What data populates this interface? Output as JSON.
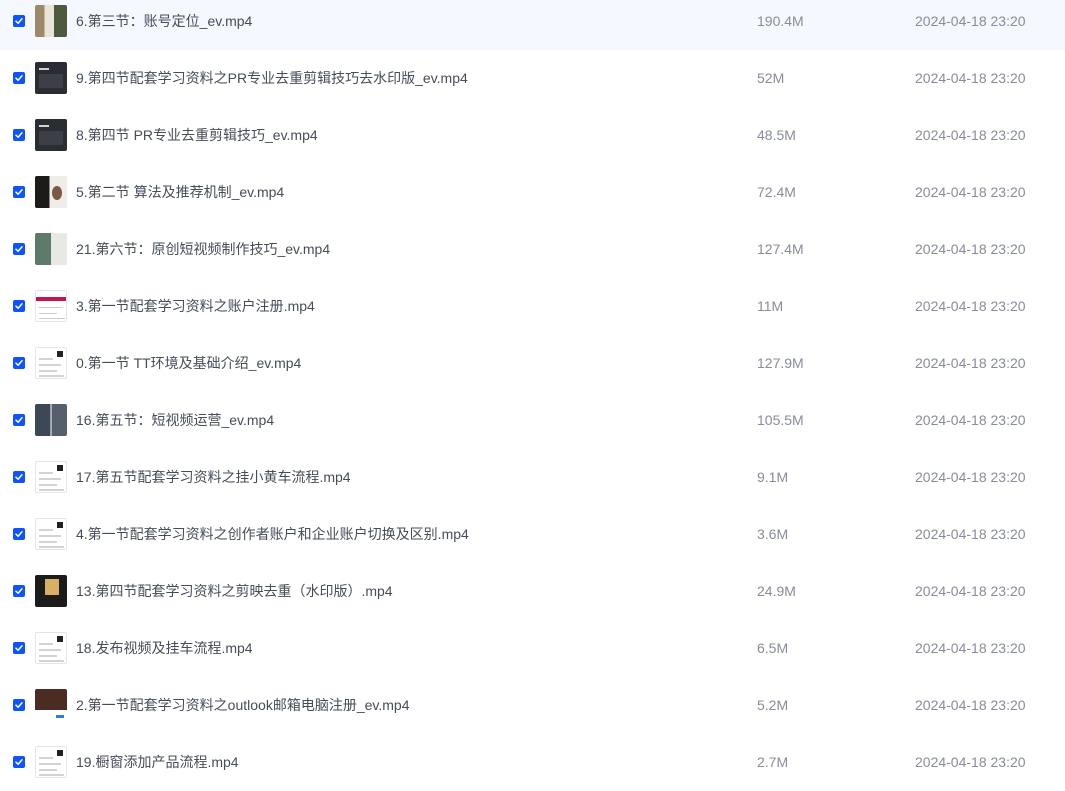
{
  "checkbox_color": "#0d53ff",
  "files": [
    {
      "name": "6.第三节：账号定位_ev.mp4",
      "size": "190.4M",
      "time": "2024-04-18 23:20",
      "checked": true,
      "thumb": "photo"
    },
    {
      "name": "9.第四节配套学习资料之PR专业去重剪辑技巧去水印版_ev.mp4",
      "size": "52M",
      "time": "2024-04-18 23:20",
      "checked": true,
      "thumb": "dark"
    },
    {
      "name": "8.第四节 PR专业去重剪辑技巧_ev.mp4",
      "size": "48.5M",
      "time": "2024-04-18 23:20",
      "checked": true,
      "thumb": "dark"
    },
    {
      "name": "5.第二节 算法及推荐机制_ev.mp4",
      "size": "72.4M",
      "time": "2024-04-18 23:20",
      "checked": true,
      "thumb": "portrait"
    },
    {
      "name": "21.第六节：原创短视频制作技巧_ev.mp4",
      "size": "127.4M",
      "time": "2024-04-18 23:20",
      "checked": true,
      "thumb": "video"
    },
    {
      "name": "3.第一节配套学习资料之账户注册.mp4",
      "size": "11M",
      "time": "2024-04-18 23:20",
      "checked": true,
      "thumb": "web"
    },
    {
      "name": "0.第一节 TT环境及基础介绍_ev.mp4",
      "size": "127.9M",
      "time": "2024-04-18 23:20",
      "checked": true,
      "thumb": "form"
    },
    {
      "name": "16.第五节：短视频运营_ev.mp4",
      "size": "105.5M",
      "time": "2024-04-18 23:20",
      "checked": true,
      "thumb": "two"
    },
    {
      "name": "17.第五节配套学习资料之挂小黄车流程.mp4",
      "size": "9.1M",
      "time": "2024-04-18 23:20",
      "checked": true,
      "thumb": "form"
    },
    {
      "name": "4.第一节配套学习资料之创作者账户和企业账户切换及区别.mp4",
      "size": "3.6M",
      "time": "2024-04-18 23:20",
      "checked": true,
      "thumb": "form"
    },
    {
      "name": "13.第四节配套学习资料之剪映去重（水印版）.mp4",
      "size": "24.9M",
      "time": "2024-04-18 23:20",
      "checked": true,
      "thumb": "gold"
    },
    {
      "name": "18.发布视频及挂车流程.mp4",
      "size": "6.5M",
      "time": "2024-04-18 23:20",
      "checked": true,
      "thumb": "form"
    },
    {
      "name": "2.第一节配套学习资料之outlook邮箱电脑注册_ev.mp4",
      "size": "5.2M",
      "time": "2024-04-18 23:20",
      "checked": true,
      "thumb": "brown"
    },
    {
      "name": "19.橱窗添加产品流程.mp4",
      "size": "2.7M",
      "time": "2024-04-18 23:20",
      "checked": true,
      "thumb": "form"
    }
  ]
}
